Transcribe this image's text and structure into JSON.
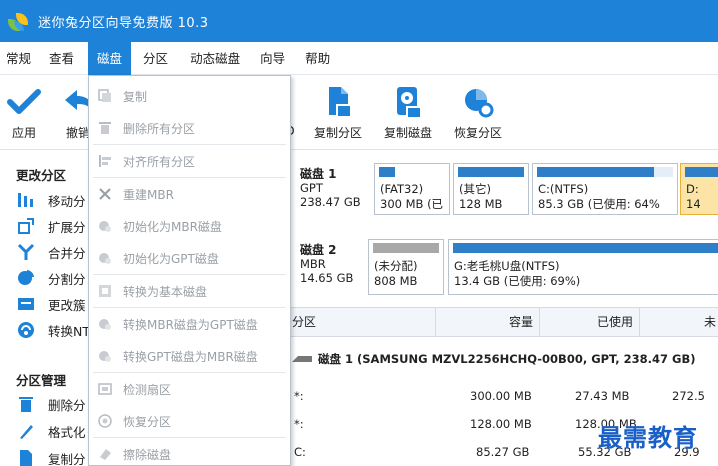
{
  "window": {
    "title": "迷你兔分区向导免费版 10.3"
  },
  "menubar": {
    "items": [
      {
        "label": "常规",
        "active": false
      },
      {
        "label": "查看",
        "active": false
      },
      {
        "label": "磁盘",
        "active": true
      },
      {
        "label": "分区",
        "active": false
      },
      {
        "label": "动态磁盘",
        "active": false
      },
      {
        "label": "向导",
        "active": false
      },
      {
        "label": "帮助",
        "active": false
      }
    ]
  },
  "toolbar": {
    "apply_label": "应用",
    "undo_label": "撤销",
    "hidden_suffix": "D",
    "copy_partition_label": "复制分区",
    "copy_disk_label": "复制磁盘",
    "recover_partition_label": "恢复分区"
  },
  "leftpanel": {
    "group1_title": "更改分区",
    "group1_items": [
      "移动分",
      "扩展分",
      "合并分",
      "分割分",
      "更改簇",
      "转换NT"
    ],
    "group2_title": "分区管理",
    "group2_items": [
      "删除分",
      "格式化",
      "复制分"
    ]
  },
  "dropdown": {
    "items": [
      "复制",
      "删除所有分区",
      "对齐所有分区",
      "重建MBR",
      "初始化为MBR磁盘",
      "初始化为GPT磁盘",
      "转换为基本磁盘",
      "转换MBR磁盘为GPT磁盘",
      "转换GPT磁盘为MBR磁盘",
      "检测扇区",
      "恢复分区",
      "擦除磁盘"
    ]
  },
  "diskmap": {
    "disks": [
      {
        "name": "磁盘 1",
        "style": "GPT",
        "size": "238.47 GB",
        "partitions": [
          {
            "line1": "(FAT32)",
            "line2": "300 MB (已"
          },
          {
            "line1": "(其它)",
            "line2": "128 MB"
          },
          {
            "line1": "C:(NTFS)",
            "line2": "85.3 GB (已使用: 64%"
          },
          {
            "line1": "D:",
            "line2": "14"
          }
        ]
      },
      {
        "name": "磁盘 2",
        "style": "MBR",
        "size": "14.65 GB",
        "partitions": [
          {
            "line1": "(未分配)",
            "line2": "808 MB"
          },
          {
            "line1": "G:老毛桃U盘(NTFS)",
            "line2": "13.4 GB (已使用: 69%)"
          }
        ]
      }
    ]
  },
  "table": {
    "headers": [
      "分区",
      "容量",
      "已使用",
      "未"
    ],
    "disk_row": "磁盘 1 (SAMSUNG MZVL2256HCHQ-00B00, GPT, 238.47 GB)",
    "rows": [
      {
        "name": "*:",
        "capacity": "300.00 MB",
        "used": "27.43 MB",
        "unused": "272.5"
      },
      {
        "name": "*:",
        "capacity": "128.00 MB",
        "used": "128.00 MB",
        "unused": ""
      },
      {
        "name": "C:",
        "capacity": "85.27 GB",
        "used": "55.32 GB",
        "unused": "29.9"
      }
    ]
  },
  "watermark": "最需教育",
  "colors": {
    "accent": "#1e82d8",
    "used_bar": "#2f7fc8",
    "unallocated_bar": "#a8a8a8",
    "selected_partition": "#fbe4a6"
  }
}
